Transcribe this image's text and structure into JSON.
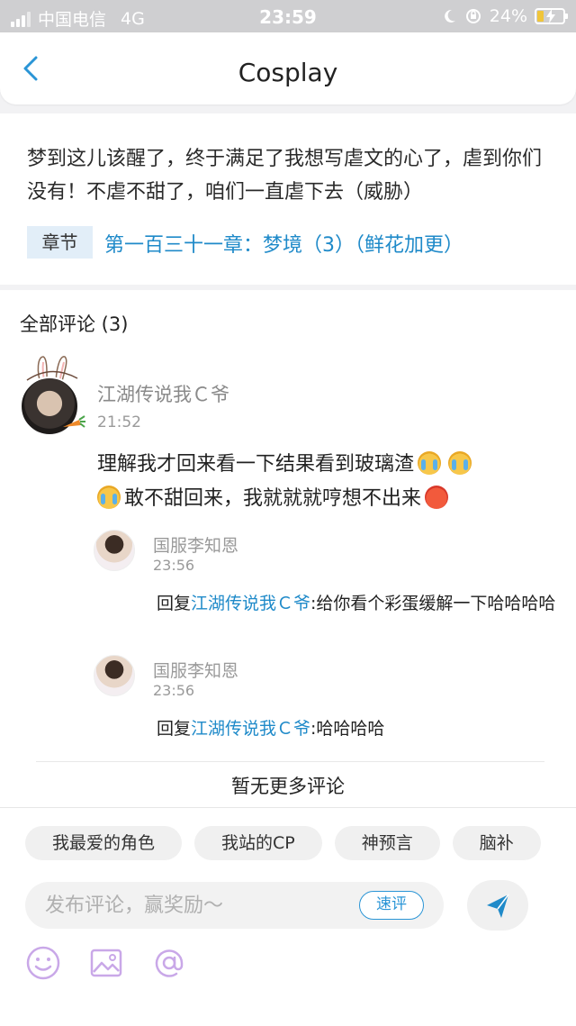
{
  "status_bar": {
    "carrier": "中国电信",
    "network": "4G",
    "time": "23:59",
    "battery": "24%",
    "battery_fill_fraction": 0.24
  },
  "header": {
    "title": "Cosplay"
  },
  "intro": {
    "text": "梦到这儿该醒了，终于满足了我想写虐文的心了，虐到你们没有！不虐不甜了，咱们一直虐下去（威胁）",
    "chapter_tag": "章节",
    "chapter_link": "第一百三十一章：梦境（3）（鲜花加更）"
  },
  "comments": {
    "heading": "全部评论 (3)",
    "main": {
      "user": "江湖传说我Ｃ爷",
      "time": "21:52",
      "text_part1": "理解我才回来看一下结果看到玻璃渣",
      "text_part2": "敢不甜回来，我就就就哼想不出来"
    },
    "replies": [
      {
        "user": "国服李知恩",
        "time": "23:56",
        "prefix": "回复",
        "target": "江湖传说我Ｃ爷",
        "text": ":给你看个彩蛋缓解一下哈哈哈哈"
      },
      {
        "user": "国服李知恩",
        "time": "23:56",
        "prefix": "回复",
        "target": "江湖传说我Ｃ爷",
        "text": ":哈哈哈哈"
      }
    ],
    "no_more": "暂无更多评论"
  },
  "bottom": {
    "chips": [
      "我最爱的角色",
      "我站的CP",
      "神预言",
      "脑补"
    ],
    "input_placeholder": "发布评论，赢奖励～",
    "quick_label": "速评"
  },
  "colors": {
    "accent": "#1f8ac9",
    "chapter_tag_bg": "#e2eef8",
    "tool_icon": "#c9a8e8"
  }
}
